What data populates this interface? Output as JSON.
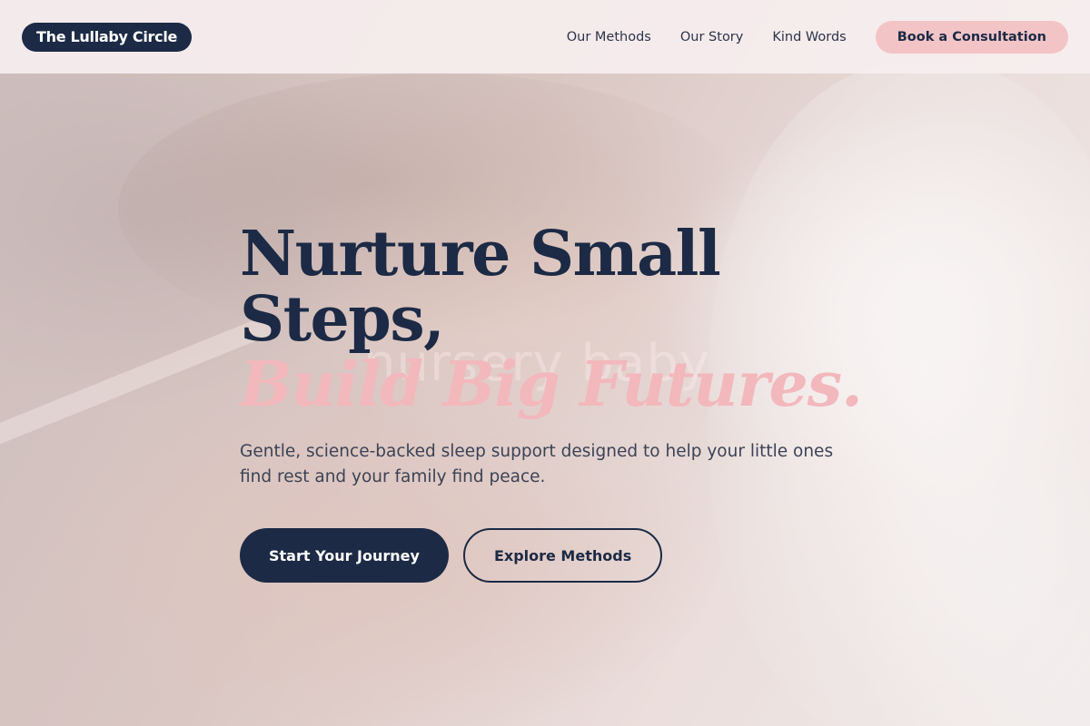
{
  "brand": {
    "name": "The Lullaby Circle"
  },
  "nav": {
    "links": [
      "Our Methods",
      "Our Story",
      "Kind Words"
    ],
    "cta_label": "Book a Consultation"
  },
  "hero": {
    "watermark": "nursery baby",
    "headline_line1": "Nurture Small",
    "headline_line2": "Steps,",
    "headline_accent": "Build Big Futures.",
    "subtitle": "Gentle, science-backed sleep support designed to help your little ones find rest and your family find peace.",
    "primary_cta": "Start Your Journey",
    "secondary_cta": "Explore Methods"
  },
  "colors": {
    "navy": "#1c2a45",
    "accent_pink": "#f2c4c6",
    "headline_accent": "#f2b8bc"
  }
}
